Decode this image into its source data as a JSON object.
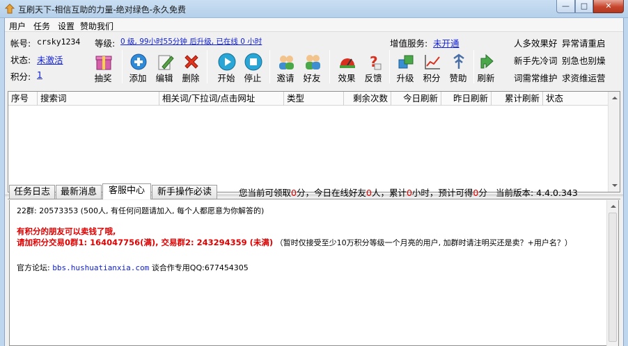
{
  "window": {
    "title": "互刷天下-相信互助的力量-绝对绿色-永久免费"
  },
  "menu": [
    "用户",
    "任务",
    "设置",
    "赞助我们"
  ],
  "account": {
    "account_label": "帐号:",
    "account_value": "crsky1234",
    "status_label": "状态:",
    "status_value": "未激活",
    "points_label": "积分:",
    "points_value": "1",
    "level_label": "等级:",
    "level_value": "0 级, 99小时55分钟 后升级, 已在线 0 小时",
    "vas_label": "增值服务:",
    "vas_value": "未开通"
  },
  "toolbar": [
    {
      "label": "抽奖",
      "icon": "lottery-box-icon"
    },
    {
      "label": "添加",
      "icon": "add-icon"
    },
    {
      "label": "编辑",
      "icon": "edit-icon"
    },
    {
      "label": "删除",
      "icon": "delete-icon"
    },
    {
      "label": "开始",
      "icon": "play-icon"
    },
    {
      "label": "停止",
      "icon": "stop-icon"
    },
    {
      "label": "邀请",
      "icon": "invite-users-icon"
    },
    {
      "label": "好友",
      "icon": "friends-icon"
    },
    {
      "label": "效果",
      "icon": "effect-icon"
    },
    {
      "label": "反馈",
      "icon": "feedback-icon"
    },
    {
      "label": "升级",
      "icon": "upgrade-icon"
    },
    {
      "label": "积分",
      "icon": "points-chart-icon"
    },
    {
      "label": "赞助",
      "icon": "sponsor-icon"
    },
    {
      "label": "刷新",
      "icon": "refresh-icon"
    }
  ],
  "ads": {
    "row1": [
      "人多效果好",
      "异常请重启"
    ],
    "row2": [
      "新手先冷词",
      "别急也别燥"
    ],
    "row3": [
      "词需常维护",
      "求资维运营"
    ]
  },
  "table": {
    "columns": [
      "序号",
      "搜索词",
      "相关词/下拉词/点击网址",
      "类型",
      "剩余次数",
      "今日刷新",
      "昨日刷新",
      "累计刷新",
      "状态"
    ],
    "rows": []
  },
  "tabs": [
    "任务日志",
    "最新消息",
    "客服中心",
    "新手操作必读"
  ],
  "active_tab": "客服中心",
  "status_bar": {
    "t1": "您当前可领取",
    "v1": "0",
    "t2": "分，今日在线好友",
    "v2": "0",
    "t3": "人，累计",
    "v3": "0",
    "t4": "小时，预计可得",
    "v4": "0",
    "t5": "分",
    "version": "当前版本: 4.4.0.343"
  },
  "content": {
    "line1": "22群: 20573353 (500人, 有任何问题请加入, 每个人都愿意为你解答的)",
    "line2": "有积分的朋友可以卖钱了哦,",
    "line3_bold": "请加积分交易0群1: 164047756(满), 交易群2: 243294359 (未满)",
    "line3_rest": "（暂时仅接受至少10万积分等级一个月亮的用户, 加群时请注明买还是卖？+用户名？）",
    "forum_label": "官方论坛:",
    "forum_url": "bbs.hushuatianxia.com",
    "forum_rest": "谈合作专用QQ:677454305"
  }
}
